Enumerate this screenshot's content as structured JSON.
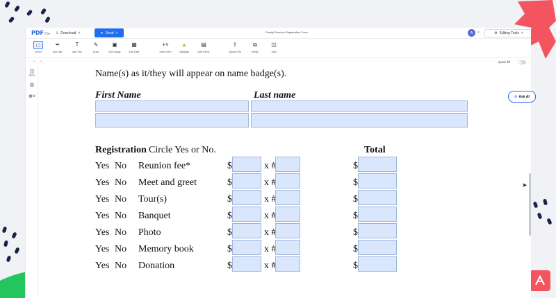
{
  "app": {
    "logo_text": "PDF",
    "logo_sub": "filler",
    "download_label": "Download",
    "send_label": "Send",
    "document_title": "Family Reunion Registration Form",
    "avatar_initial": "A",
    "editing_tools_label": "Editing Tools",
    "accent_color": "#1f6ef0"
  },
  "toolbar": {
    "items": [
      {
        "label": "Select",
        "icon": "select-icon"
      },
      {
        "label": "Add Sign",
        "icon": "pen-icon"
      },
      {
        "label": "Add Text",
        "icon": "text-icon"
      },
      {
        "label": "Draw",
        "icon": "draw-icon"
      },
      {
        "label": "Add Image",
        "icon": "image-icon"
      },
      {
        "label": "Add Date",
        "icon": "calendar-icon"
      },
      {
        "label": "Insert Item",
        "icon": "plus-icon"
      },
      {
        "label": "Highlight",
        "icon": "highlight-icon"
      },
      {
        "label": "Add Fields",
        "icon": "fields-icon"
      },
      {
        "label": "Upload File",
        "icon": "upload-icon"
      },
      {
        "label": "Merge",
        "icon": "merge-icon"
      },
      {
        "label": "Split",
        "icon": "split-icon"
      }
    ]
  },
  "subbar": {
    "quick_fill_label": "Quick fill"
  },
  "sidebar": {
    "items": [
      {
        "label": "25/41",
        "icon": "pages-icon"
      },
      {
        "label": "",
        "icon": "settings-icon"
      },
      {
        "label": "",
        "icon": "zoom-icon"
      }
    ]
  },
  "ask_ai_label": "Ask AI",
  "form": {
    "intro": "Name(s) as it/they will appear on name badge(s).",
    "first_name_header": "First Name",
    "last_name_header": "Last name",
    "registration_header": "Registration",
    "circle_instruction": "Circle Yes or No.",
    "total_header": "Total",
    "yes_label": "Yes",
    "no_label": "No",
    "dollar_sign": "$",
    "times_label": "x #",
    "rows": [
      {
        "label": "Reunion fee*"
      },
      {
        "label": "Meet and greet"
      },
      {
        "label": "Tour(s)"
      },
      {
        "label": "Banquet"
      },
      {
        "label": "Photo"
      },
      {
        "label": "Memory book"
      },
      {
        "label": "Donation"
      }
    ]
  }
}
